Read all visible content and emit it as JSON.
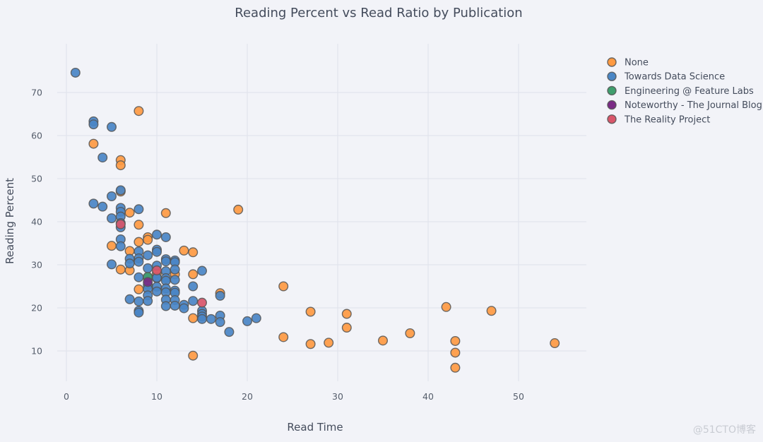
{
  "chart_data": {
    "type": "scatter",
    "title": "Reading Percent vs Read Ratio by Publication",
    "xlabel": "Read Time",
    "ylabel": "Reading Percent",
    "xlim": [
      -1,
      57.5
    ],
    "ylim": [
      2,
      80
    ],
    "xticks": [
      0,
      10,
      20,
      30,
      40,
      50
    ],
    "yticks": [
      10,
      20,
      30,
      40,
      50,
      60,
      70
    ],
    "grid": true,
    "legend_position": "top-right",
    "series": [
      {
        "name": "None",
        "color": "#ff9a42",
        "points": [
          [
            3,
            58.1
          ],
          [
            6,
            54.3
          ],
          [
            6,
            53.1
          ],
          [
            8,
            65.7
          ],
          [
            11,
            42.0
          ],
          [
            7,
            42.1
          ],
          [
            8,
            39.3
          ],
          [
            9,
            36.4
          ],
          [
            9,
            35.8
          ],
          [
            5,
            34.4
          ],
          [
            8,
            35.3
          ],
          [
            7,
            33.2
          ],
          [
            13,
            33.3
          ],
          [
            14,
            32.9
          ],
          [
            6,
            28.9
          ],
          [
            7,
            28.7
          ],
          [
            12,
            27.8
          ],
          [
            14,
            27.8
          ],
          [
            8,
            24.3
          ],
          [
            17,
            23.4
          ],
          [
            19,
            42.8
          ],
          [
            14,
            17.6
          ],
          [
            14,
            8.9
          ],
          [
            24,
            25.0
          ],
          [
            24,
            13.2
          ],
          [
            27,
            19.1
          ],
          [
            27,
            11.6
          ],
          [
            29,
            11.9
          ],
          [
            31,
            18.6
          ],
          [
            31,
            15.4
          ],
          [
            35,
            12.4
          ],
          [
            38,
            14.1
          ],
          [
            42,
            20.2
          ],
          [
            43,
            12.3
          ],
          [
            43,
            9.6
          ],
          [
            43,
            6.1
          ],
          [
            47,
            19.3
          ],
          [
            54,
            11.8
          ],
          [
            6,
            47.0
          ],
          [
            10,
            28.0
          ]
        ]
      },
      {
        "name": "Towards Data Science",
        "color": "#4a86c5",
        "points": [
          [
            1,
            74.6
          ],
          [
            3,
            63.3
          ],
          [
            3,
            62.6
          ],
          [
            5,
            62.0
          ],
          [
            4,
            54.9
          ],
          [
            6,
            47.3
          ],
          [
            5,
            45.9
          ],
          [
            3,
            44.2
          ],
          [
            4,
            43.5
          ],
          [
            6,
            43.2
          ],
          [
            6,
            42.3
          ],
          [
            8,
            42.9
          ],
          [
            6,
            41.2
          ],
          [
            5,
            40.8
          ],
          [
            6,
            38.7
          ],
          [
            6,
            35.9
          ],
          [
            6,
            34.3
          ],
          [
            9,
            32.2
          ],
          [
            10,
            37.0
          ],
          [
            11,
            36.4
          ],
          [
            10,
            33.5
          ],
          [
            10,
            33.0
          ],
          [
            8,
            33.1
          ],
          [
            8,
            31.5
          ],
          [
            8,
            30.7
          ],
          [
            7,
            31.4
          ],
          [
            7,
            30.3
          ],
          [
            5,
            30.1
          ],
          [
            9,
            29.2
          ],
          [
            10,
            29.8
          ],
          [
            11,
            31.3
          ],
          [
            11,
            30.8
          ],
          [
            12,
            31.0
          ],
          [
            12,
            30.6
          ],
          [
            11,
            28.5
          ],
          [
            12,
            28.9
          ],
          [
            8,
            27.1
          ],
          [
            9,
            27.0
          ],
          [
            10,
            26.9
          ],
          [
            11,
            26.9
          ],
          [
            11,
            26.3
          ],
          [
            12,
            26.5
          ],
          [
            9,
            25.3
          ],
          [
            9,
            24.4
          ],
          [
            10,
            24.9
          ],
          [
            11,
            24.5
          ],
          [
            11,
            23.6
          ],
          [
            12,
            24.0
          ],
          [
            12,
            23.5
          ],
          [
            10,
            23.8
          ],
          [
            9,
            22.9
          ],
          [
            9,
            21.6
          ],
          [
            7,
            22.0
          ],
          [
            8,
            21.5
          ],
          [
            11,
            21.9
          ],
          [
            11,
            20.4
          ],
          [
            12,
            21.8
          ],
          [
            12,
            20.5
          ],
          [
            13,
            20.7
          ],
          [
            13,
            19.9
          ],
          [
            8,
            19.3
          ],
          [
            8,
            18.9
          ],
          [
            14,
            25.0
          ],
          [
            14,
            21.6
          ],
          [
            15,
            28.6
          ],
          [
            15,
            19.3
          ],
          [
            15,
            18.6
          ],
          [
            15,
            18.0
          ],
          [
            15,
            17.4
          ],
          [
            16,
            17.4
          ],
          [
            17,
            18.2
          ],
          [
            17,
            16.7
          ],
          [
            17,
            22.8
          ],
          [
            18,
            14.4
          ],
          [
            20,
            16.9
          ],
          [
            21,
            17.6
          ],
          [
            6,
            39.7
          ],
          [
            10,
            27.0
          ]
        ]
      },
      {
        "name": "Engineering @ Feature Labs",
        "color": "#3f9e6d",
        "points": [
          [
            9,
            27.2
          ]
        ]
      },
      {
        "name": "Noteworthy - The Journal Blog",
        "color": "#7a2b85",
        "points": [
          [
            9,
            26.0
          ]
        ]
      },
      {
        "name": "The Reality Project",
        "color": "#d9566a",
        "points": [
          [
            6,
            39.4
          ],
          [
            10,
            28.7
          ],
          [
            15,
            21.2
          ]
        ]
      }
    ]
  },
  "watermark": "@51CTO博客"
}
